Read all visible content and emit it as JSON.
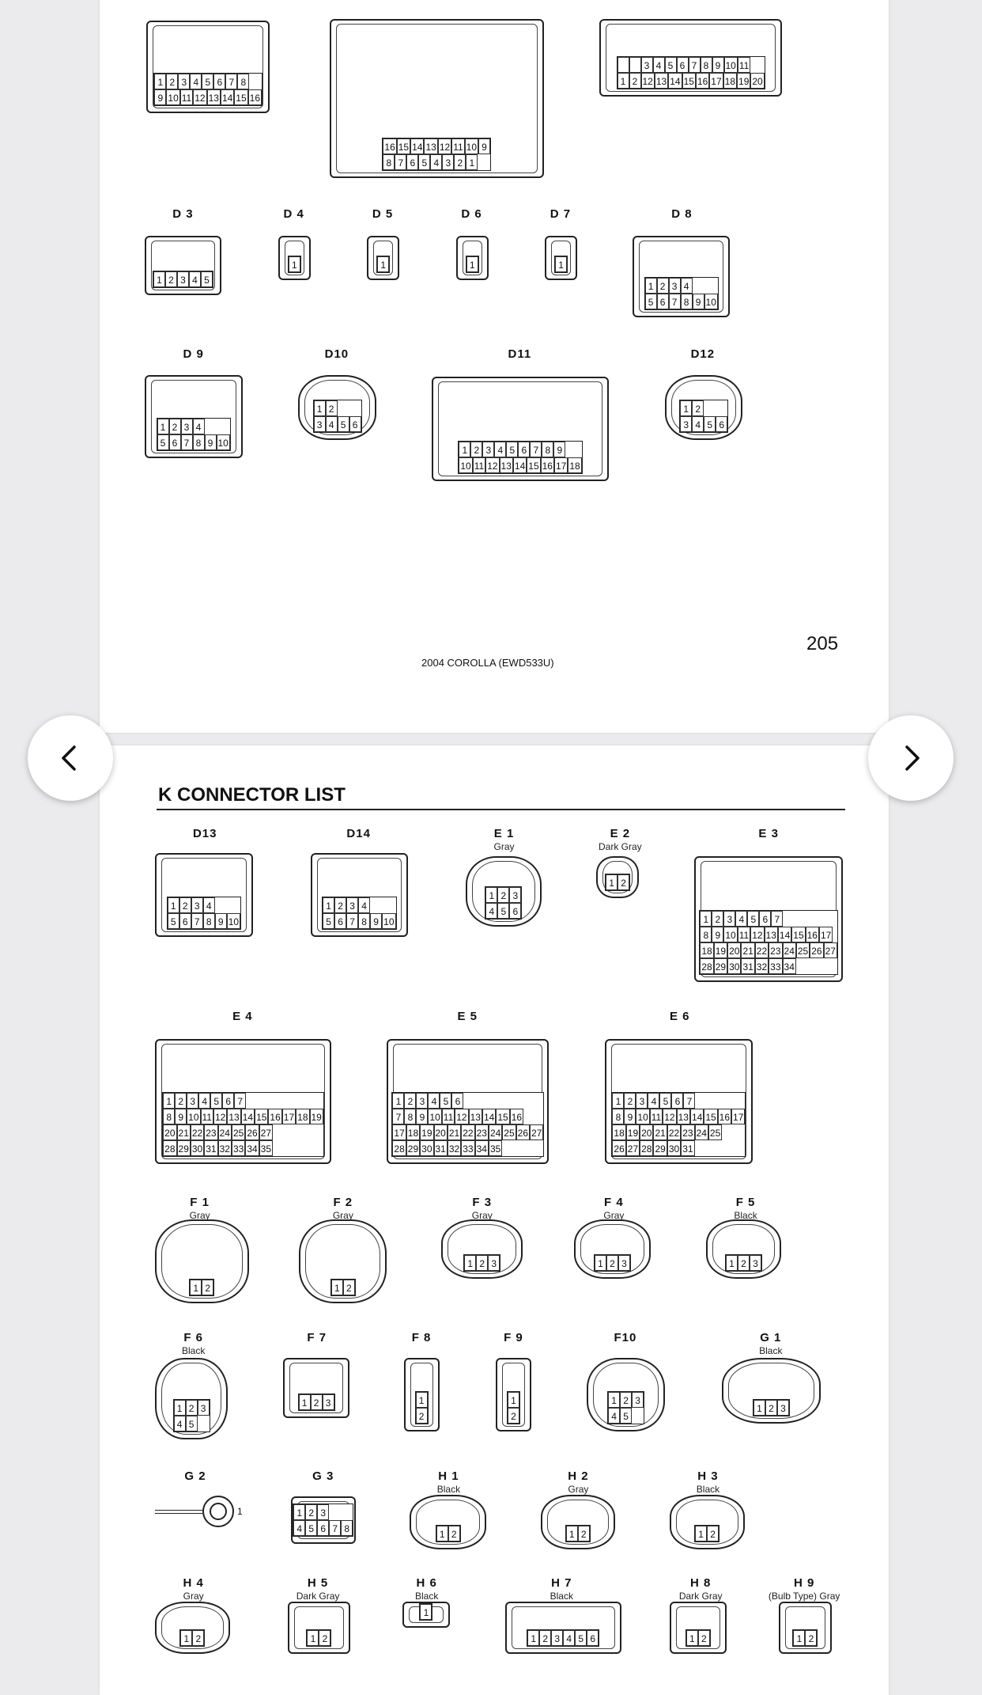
{
  "document": {
    "page_number": "205",
    "footer": "2004 COROLLA (EWD533U)",
    "section_title": "K  CONNECTOR LIST"
  },
  "navigation": {
    "prev_icon": "chevron-left-icon",
    "next_icon": "chevron-right-icon"
  },
  "page1_connectors": [
    {
      "id": "top-a",
      "label": "",
      "color": "",
      "rows": [
        [
          "1",
          "2",
          "3",
          "4",
          "5",
          "6",
          "7",
          "8"
        ],
        [
          "9",
          "10",
          "11",
          "12",
          "13",
          "14",
          "15",
          "16"
        ]
      ]
    },
    {
      "id": "top-b",
      "label": "",
      "color": "",
      "rows": [
        [
          "16",
          "15",
          "14",
          "13",
          "12",
          "11",
          "10",
          "9"
        ],
        [
          "8",
          "7",
          "6",
          "5",
          "4",
          "3",
          "2",
          "1"
        ]
      ]
    },
    {
      "id": "top-c",
      "label": "",
      "color": "",
      "rows": [
        [
          "",
          "",
          "3",
          "4",
          "5",
          "6",
          "7",
          "8",
          "9",
          "10",
          "11"
        ],
        [
          "1",
          "2",
          "12",
          "13",
          "14",
          "15",
          "16",
          "17",
          "18",
          "19",
          "20"
        ]
      ]
    },
    {
      "id": "d3",
      "label": "D 3",
      "color": "",
      "rows": [
        [
          "1",
          "2",
          "3",
          "4",
          "5"
        ]
      ]
    },
    {
      "id": "d4",
      "label": "D 4",
      "color": "",
      "rows": [
        [
          "1"
        ]
      ]
    },
    {
      "id": "d5",
      "label": "D 5",
      "color": "",
      "rows": [
        [
          "1"
        ]
      ]
    },
    {
      "id": "d6",
      "label": "D 6",
      "color": "",
      "rows": [
        [
          "1"
        ]
      ]
    },
    {
      "id": "d7",
      "label": "D 7",
      "color": "",
      "rows": [
        [
          "1"
        ]
      ]
    },
    {
      "id": "d8",
      "label": "D 8",
      "color": "",
      "rows": [
        [
          "1",
          "2",
          "3",
          "4"
        ],
        [
          "5",
          "6",
          "7",
          "8",
          "9",
          "10"
        ]
      ]
    },
    {
      "id": "d9",
      "label": "D 9",
      "color": "",
      "rows": [
        [
          "1",
          "2",
          "3",
          "4"
        ],
        [
          "5",
          "6",
          "7",
          "8",
          "9",
          "10"
        ]
      ]
    },
    {
      "id": "d10",
      "label": "D10",
      "color": "",
      "rows": [
        [
          "1",
          "2"
        ],
        [
          "3",
          "4",
          "5",
          "6"
        ]
      ]
    },
    {
      "id": "d11",
      "label": "D11",
      "color": "",
      "rows": [
        [
          "1",
          "2",
          "3",
          "4",
          "5",
          "6",
          "7",
          "8",
          "9"
        ],
        [
          "10",
          "11",
          "12",
          "13",
          "14",
          "15",
          "16",
          "17",
          "18"
        ]
      ]
    },
    {
      "id": "d12",
      "label": "D12",
      "color": "",
      "rows": [
        [
          "1",
          "2"
        ],
        [
          "3",
          "4",
          "5",
          "6"
        ]
      ]
    }
  ],
  "page2_connectors": [
    {
      "id": "d13",
      "label": "D13",
      "color": "",
      "rows": [
        [
          "1",
          "2",
          "3",
          "4"
        ],
        [
          "5",
          "6",
          "7",
          "8",
          "9",
          "10"
        ]
      ]
    },
    {
      "id": "d14",
      "label": "D14",
      "color": "",
      "rows": [
        [
          "1",
          "2",
          "3",
          "4"
        ],
        [
          "5",
          "6",
          "7",
          "8",
          "9",
          "10"
        ]
      ]
    },
    {
      "id": "e1",
      "label": "E 1",
      "color": "Gray",
      "rows": [
        [
          "1",
          "2",
          "3"
        ],
        [
          "4",
          "5",
          "6"
        ]
      ]
    },
    {
      "id": "e2",
      "label": "E 2",
      "color": "Dark Gray",
      "rows": [
        [
          "1",
          "2"
        ]
      ]
    },
    {
      "id": "e3",
      "label": "E 3",
      "color": "",
      "rows": [
        [
          "1",
          "2",
          "3",
          "4",
          "5",
          "6",
          "7"
        ],
        [
          "8",
          "9",
          "10",
          "11",
          "12",
          "13",
          "14",
          "15",
          "16",
          "17"
        ],
        [
          "18",
          "19",
          "20",
          "21",
          "22",
          "23",
          "24",
          "25",
          "26",
          "27"
        ],
        [
          "28",
          "29",
          "30",
          "31",
          "32",
          "33",
          "34"
        ]
      ]
    },
    {
      "id": "e4",
      "label": "E 4",
      "color": "",
      "rows": [
        [
          "1",
          "2",
          "3",
          "4",
          "5",
          "6",
          "7"
        ],
        [
          "8",
          "9",
          "10",
          "11",
          "12",
          "13",
          "14",
          "15",
          "16",
          "17",
          "18",
          "19"
        ],
        [
          "20",
          "21",
          "22",
          "23",
          "24",
          "25",
          "26",
          "27"
        ],
        [
          "28",
          "29",
          "30",
          "31",
          "32",
          "33",
          "34",
          "35"
        ]
      ]
    },
    {
      "id": "e5",
      "label": "E 5",
      "color": "",
      "rows": [
        [
          "1",
          "2",
          "3",
          "4",
          "5",
          "6"
        ],
        [
          "7",
          "8",
          "9",
          "10",
          "11",
          "12",
          "13",
          "14",
          "15",
          "16"
        ],
        [
          "17",
          "18",
          "19",
          "20",
          "21",
          "22",
          "23",
          "24",
          "25",
          "26",
          "27"
        ],
        [
          "28",
          "29",
          "30",
          "31",
          "32",
          "33",
          "34",
          "35"
        ]
      ]
    },
    {
      "id": "e6",
      "label": "E 6",
      "color": "",
      "rows": [
        [
          "1",
          "2",
          "3",
          "4",
          "5",
          "6",
          "7"
        ],
        [
          "8",
          "9",
          "10",
          "11",
          "12",
          "13",
          "14",
          "15",
          "16",
          "17"
        ],
        [
          "18",
          "19",
          "20",
          "21",
          "22",
          "23",
          "24",
          "25"
        ],
        [
          "26",
          "27",
          "28",
          "29",
          "30",
          "31"
        ]
      ]
    },
    {
      "id": "f1",
      "label": "F 1",
      "color": "Gray",
      "rows": [
        [
          "1",
          "2"
        ]
      ]
    },
    {
      "id": "f2",
      "label": "F 2",
      "color": "Gray",
      "rows": [
        [
          "1",
          "2"
        ]
      ]
    },
    {
      "id": "f3",
      "label": "F 3",
      "color": "Gray",
      "rows": [
        [
          "1",
          "2",
          "3"
        ]
      ]
    },
    {
      "id": "f4",
      "label": "F 4",
      "color": "Gray",
      "rows": [
        [
          "1",
          "2",
          "3"
        ]
      ]
    },
    {
      "id": "f5",
      "label": "F 5",
      "color": "Black",
      "rows": [
        [
          "1",
          "2",
          "3"
        ]
      ]
    },
    {
      "id": "f6",
      "label": "F 6",
      "color": "Black",
      "rows": [
        [
          "1",
          "2",
          "3"
        ],
        [
          "4",
          "5"
        ]
      ]
    },
    {
      "id": "f7",
      "label": "F 7",
      "color": "",
      "rows": [
        [
          "1",
          "2",
          "3"
        ]
      ]
    },
    {
      "id": "f8",
      "label": "F 8",
      "color": "",
      "rows": [
        [
          "1"
        ],
        [
          "2"
        ]
      ]
    },
    {
      "id": "f9",
      "label": "F 9",
      "color": "",
      "rows": [
        [
          "1"
        ],
        [
          "2"
        ]
      ]
    },
    {
      "id": "f10",
      "label": "F10",
      "color": "",
      "rows": [
        [
          "1",
          "2",
          "3"
        ],
        [
          "4",
          "5"
        ]
      ]
    },
    {
      "id": "g1",
      "label": "G 1",
      "color": "Black",
      "rows": [
        [
          "1",
          "2",
          "3"
        ]
      ]
    },
    {
      "id": "g3",
      "label": "G 3",
      "color": "",
      "rows": [
        [
          "1",
          "2",
          "3"
        ],
        [
          "4",
          "5",
          "6",
          "7",
          "8"
        ]
      ]
    },
    {
      "id": "h1",
      "label": "H 1",
      "color": "Black",
      "rows": [
        [
          "1",
          "2"
        ]
      ]
    },
    {
      "id": "h2",
      "label": "H 2",
      "color": "Gray",
      "rows": [
        [
          "1",
          "2"
        ]
      ]
    },
    {
      "id": "h3",
      "label": "H 3",
      "color": "Black",
      "rows": [
        [
          "1",
          "2"
        ]
      ]
    },
    {
      "id": "h4",
      "label": "H 4",
      "color": "Gray",
      "rows": [
        [
          "1",
          "2"
        ]
      ]
    },
    {
      "id": "h5",
      "label": "H 5",
      "color": "Dark Gray",
      "rows": [
        [
          "1",
          "2"
        ]
      ]
    },
    {
      "id": "h6",
      "label": "H 6",
      "color": "Black",
      "rows": [
        [
          "1"
        ]
      ]
    },
    {
      "id": "h7",
      "label": "H 7",
      "color": "Black",
      "rows": [
        [
          "1",
          "2",
          "3",
          "4",
          "5",
          "6"
        ]
      ]
    },
    {
      "id": "h8",
      "label": "H 8",
      "color": "Dark Gray",
      "rows": [
        [
          "1",
          "2"
        ]
      ]
    },
    {
      "id": "h9",
      "label": "H 9",
      "color": "(Bulb Type)  Gray",
      "rows": [
        [
          "1",
          "2"
        ]
      ]
    }
  ],
  "ring_terminal": {
    "label": "G 2",
    "pin": "1"
  }
}
